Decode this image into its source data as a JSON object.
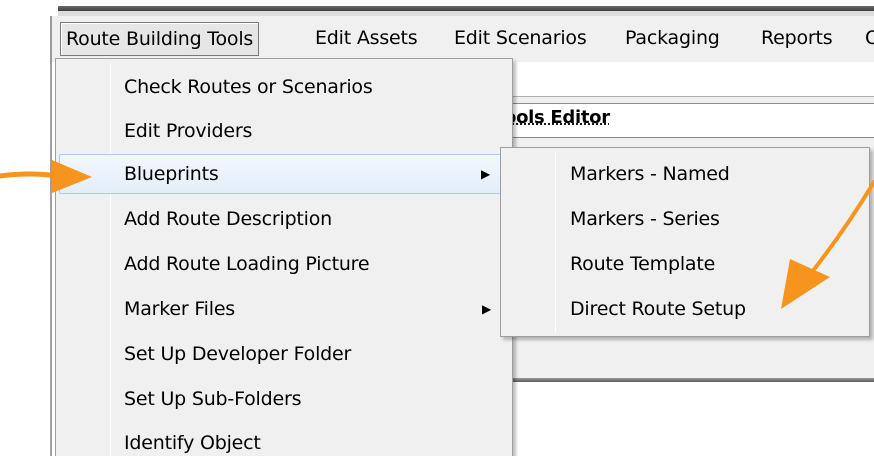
{
  "menubar": {
    "items": [
      {
        "label": "Route Building Tools",
        "active": true
      },
      {
        "label": "Edit Assets"
      },
      {
        "label": "Edit Scenarios"
      },
      {
        "label": "Packaging"
      },
      {
        "label": "Reports"
      },
      {
        "label": "O"
      }
    ]
  },
  "editor": {
    "title_fragment": "ools Editor"
  },
  "dropdown": {
    "items": [
      {
        "label": "Check Routes or Scenarios"
      },
      {
        "label": "Edit Providers"
      },
      {
        "label": "Blueprints",
        "submenu": true,
        "highlighted": true
      },
      {
        "label": "Add Route Description"
      },
      {
        "label": "Add Route Loading Picture"
      },
      {
        "label": "Marker Files",
        "submenu": true
      },
      {
        "label": "Set Up Developer Folder"
      },
      {
        "label": "Set Up Sub-Folders"
      },
      {
        "label": "Identify Object"
      }
    ],
    "submenu_arrow": "▶"
  },
  "submenu": {
    "items": [
      {
        "label": "Markers - Named"
      },
      {
        "label": "Markers - Series"
      },
      {
        "label": "Route Template"
      },
      {
        "label": "Direct Route Setup"
      }
    ]
  },
  "annotations": {
    "arrow_color": "#f7941d"
  }
}
